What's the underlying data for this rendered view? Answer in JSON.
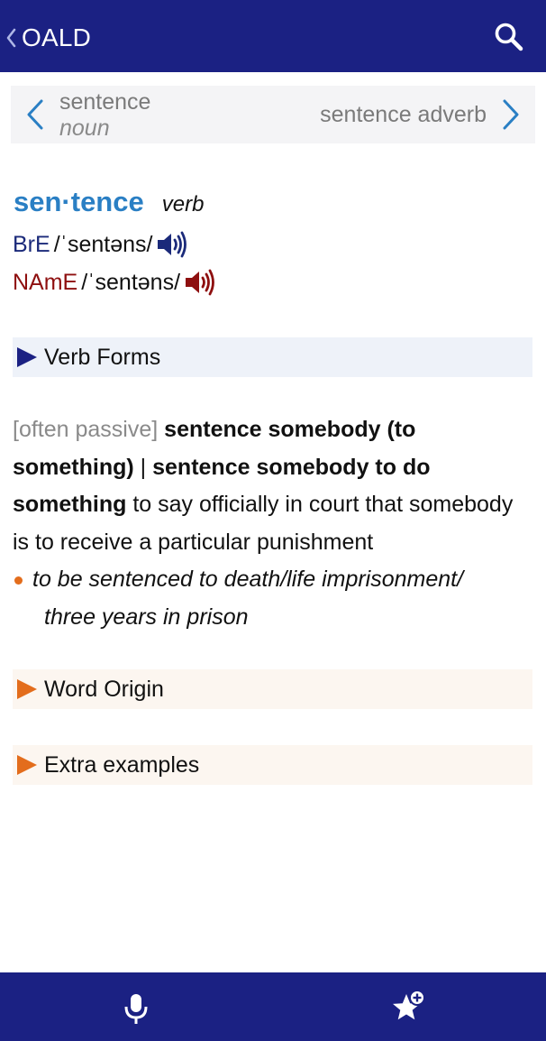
{
  "topbar": {
    "title": "OALD"
  },
  "nav": {
    "prev": {
      "word": "sentence",
      "pos": "noun"
    },
    "next": {
      "word": "sentence adverb"
    }
  },
  "entry": {
    "headword": "sen·tence",
    "pos": "verb",
    "bre": {
      "label": "BrE",
      "ipa": "/ˈsentəns/"
    },
    "name": {
      "label": "NAmE",
      "ipa": "/ˈsentəns/"
    }
  },
  "sections": {
    "verb_forms": "Verb Forms",
    "word_origin": "Word Origin",
    "extra_examples": "Extra examples"
  },
  "sense": {
    "grammar": "[often passive]",
    "cf1": "sentence somebody (to something)",
    "separator": "|",
    "cf2": "sentence somebody to do something",
    "definition": "to say officially in court that somebody is to receive a particular punishment",
    "example_line1": "to be sentenced to death/life imprisonment/",
    "example_line2": "three years in prison"
  },
  "colors": {
    "brand_navy": "#1b2183",
    "headword_blue": "#2a7fc4",
    "bre_navy": "#1b2a7a",
    "name_red": "#8e0f0f",
    "accent_orange": "#e36d1c"
  },
  "icons": {
    "back": "chevron-left-icon",
    "search": "search-icon",
    "prev": "chevron-left-icon",
    "next": "chevron-right-icon",
    "speaker": "speaker-icon",
    "verb_forms": "triangle-right-icon",
    "mic": "microphone-icon",
    "favourite": "star-plus-icon"
  }
}
